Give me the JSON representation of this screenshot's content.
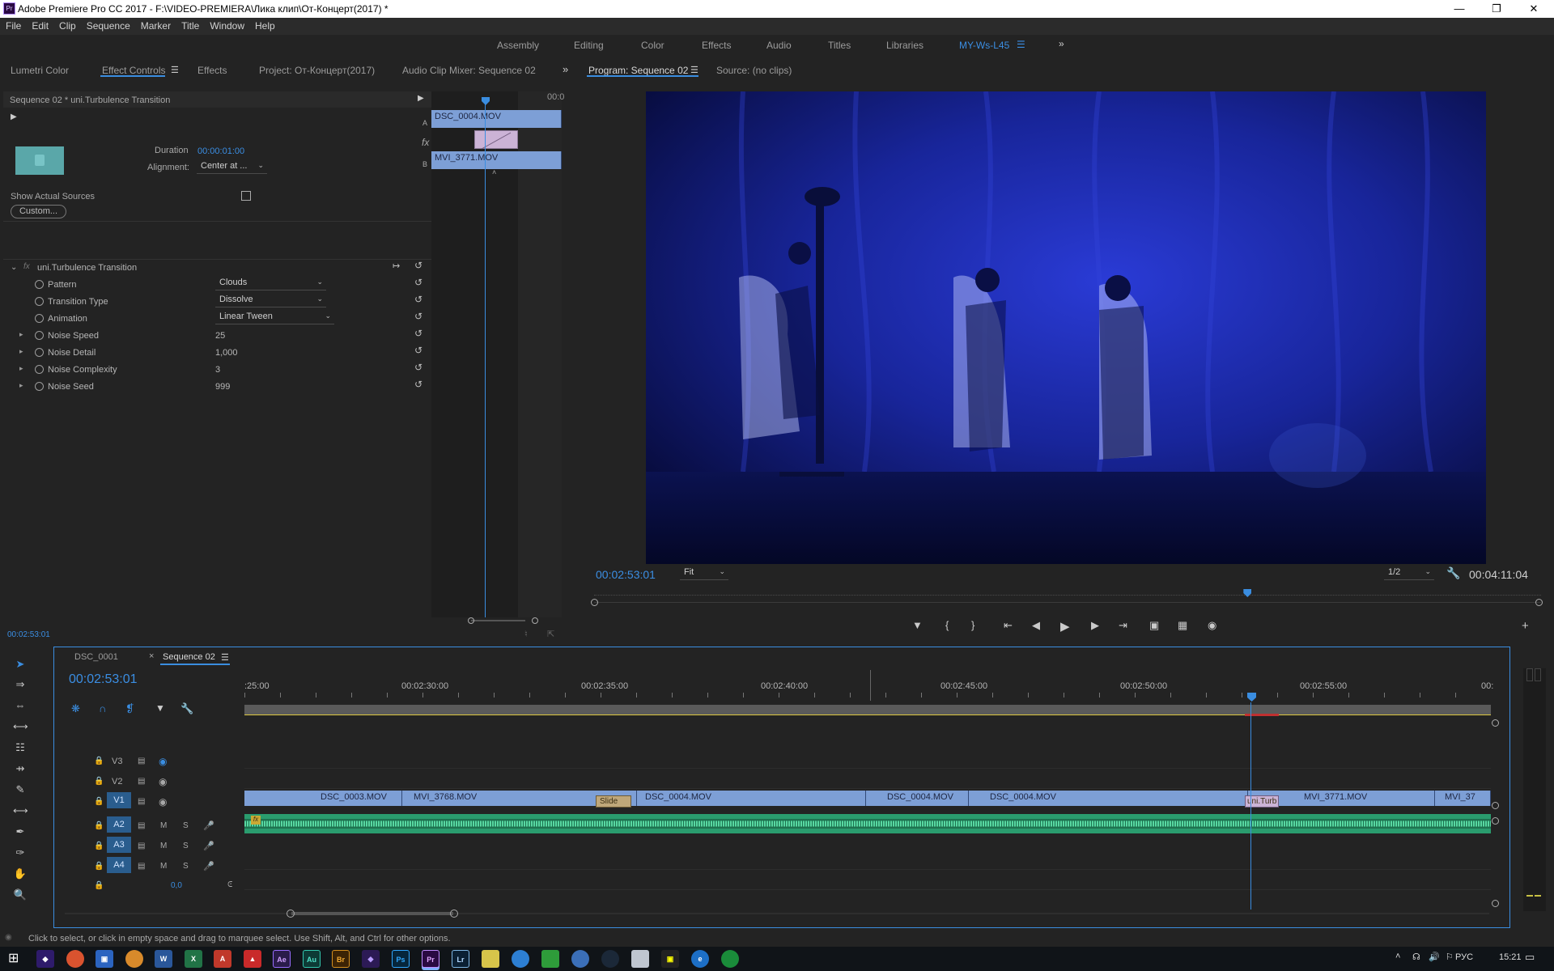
{
  "window": {
    "app_title": "Adobe Premiere Pro CC 2017 - F:\\VIDEO-PREMIERA\\Лика клип\\От-Концерт(2017) *",
    "app_icon": "Pr"
  },
  "menu": [
    "File",
    "Edit",
    "Clip",
    "Sequence",
    "Marker",
    "Title",
    "Window",
    "Help"
  ],
  "workspaces": [
    "Assembly",
    "Editing",
    "Color",
    "Effects",
    "Audio",
    "Titles",
    "Libraries",
    "MY-Ws-L45"
  ],
  "left_tabs": [
    "Lumetri Color",
    "Effect Controls",
    "Effects",
    "Project: От-Концерт(2017)",
    "Audio Clip Mixer: Sequence 02"
  ],
  "effect_controls": {
    "header": "Sequence 02 * uni.Turbulence Transition",
    "duration_label": "Duration",
    "duration_value": "00:00:01:00",
    "alignment_label": "Alignment:",
    "alignment_value": "Center at ...",
    "show_actual_sources": "Show Actual Sources",
    "custom_button": "Custom...",
    "effect_name": "uni.Turbulence Transition",
    "params": [
      {
        "name": "Pattern",
        "value": "Clouds",
        "kind": "dropdown"
      },
      {
        "name": "Transition Type",
        "value": "Dissolve",
        "kind": "dropdown"
      },
      {
        "name": "Animation",
        "value": "Linear Tween",
        "kind": "dropdown"
      },
      {
        "name": "Noise Speed",
        "value": "25",
        "kind": "number"
      },
      {
        "name": "Noise Detail",
        "value": "1,000",
        "kind": "number"
      },
      {
        "name": "Noise Complexity",
        "value": "3",
        "kind": "number"
      },
      {
        "name": "Noise Seed",
        "value": "999",
        "kind": "number"
      }
    ],
    "mini_timeline": {
      "ruler": "00:0",
      "track_a_label": "A",
      "track_b_label": "B",
      "clip_a": "DSC_0004.MOV",
      "clip_b": "MVI_3771.MOV",
      "fx": "fx"
    },
    "timecode": "00:02:53:01"
  },
  "program_monitor": {
    "tab": "Program: Sequence 02",
    "source_tab": "Source: (no clips)",
    "timecode": "00:02:53:01",
    "fit": "Fit",
    "resolution": "1/2",
    "duration": "00:04:11:04",
    "playhead_fraction": 0.69
  },
  "timeline": {
    "tabs": [
      "DSC_0001",
      "Sequence 02"
    ],
    "timecode": "00:02:53:01",
    "ruler": [
      ":25:00",
      "00:02:30:00",
      "00:02:35:00",
      "00:02:40:00",
      "00:02:45:00",
      "00:02:50:00",
      "00:02:55:00",
      "00:"
    ],
    "tracks": [
      {
        "name": "V3",
        "type": "video"
      },
      {
        "name": "V2",
        "type": "video"
      },
      {
        "name": "V1",
        "type": "video"
      },
      {
        "name": "A2",
        "type": "audio",
        "m": "M",
        "s": "S"
      },
      {
        "name": "A3",
        "type": "audio",
        "m": "M",
        "s": "S"
      },
      {
        "name": "A4",
        "type": "audio",
        "m": "M",
        "s": "S"
      }
    ],
    "master_value": "0,0",
    "v1_clips": [
      "DSC_0003.MOV",
      "MVI_3768.MOV",
      "DSC_0004.MOV",
      "DSC_0004.MOV",
      "DSC_0004.MOV",
      "MVI_3771.MOV",
      "MVI_37"
    ],
    "transitions": [
      "Slide",
      "uni.Turb"
    ]
  },
  "status_bar": "Click to select, or click in empty space and drag to marquee select. Use Shift, Alt, and Ctrl for other options.",
  "taskbar": {
    "lang": "РУС",
    "time": "15:21",
    "apps": [
      "W",
      "X",
      "A",
      "Ae",
      "Au",
      "Br",
      "Ps",
      "Pr",
      "Lr"
    ]
  }
}
